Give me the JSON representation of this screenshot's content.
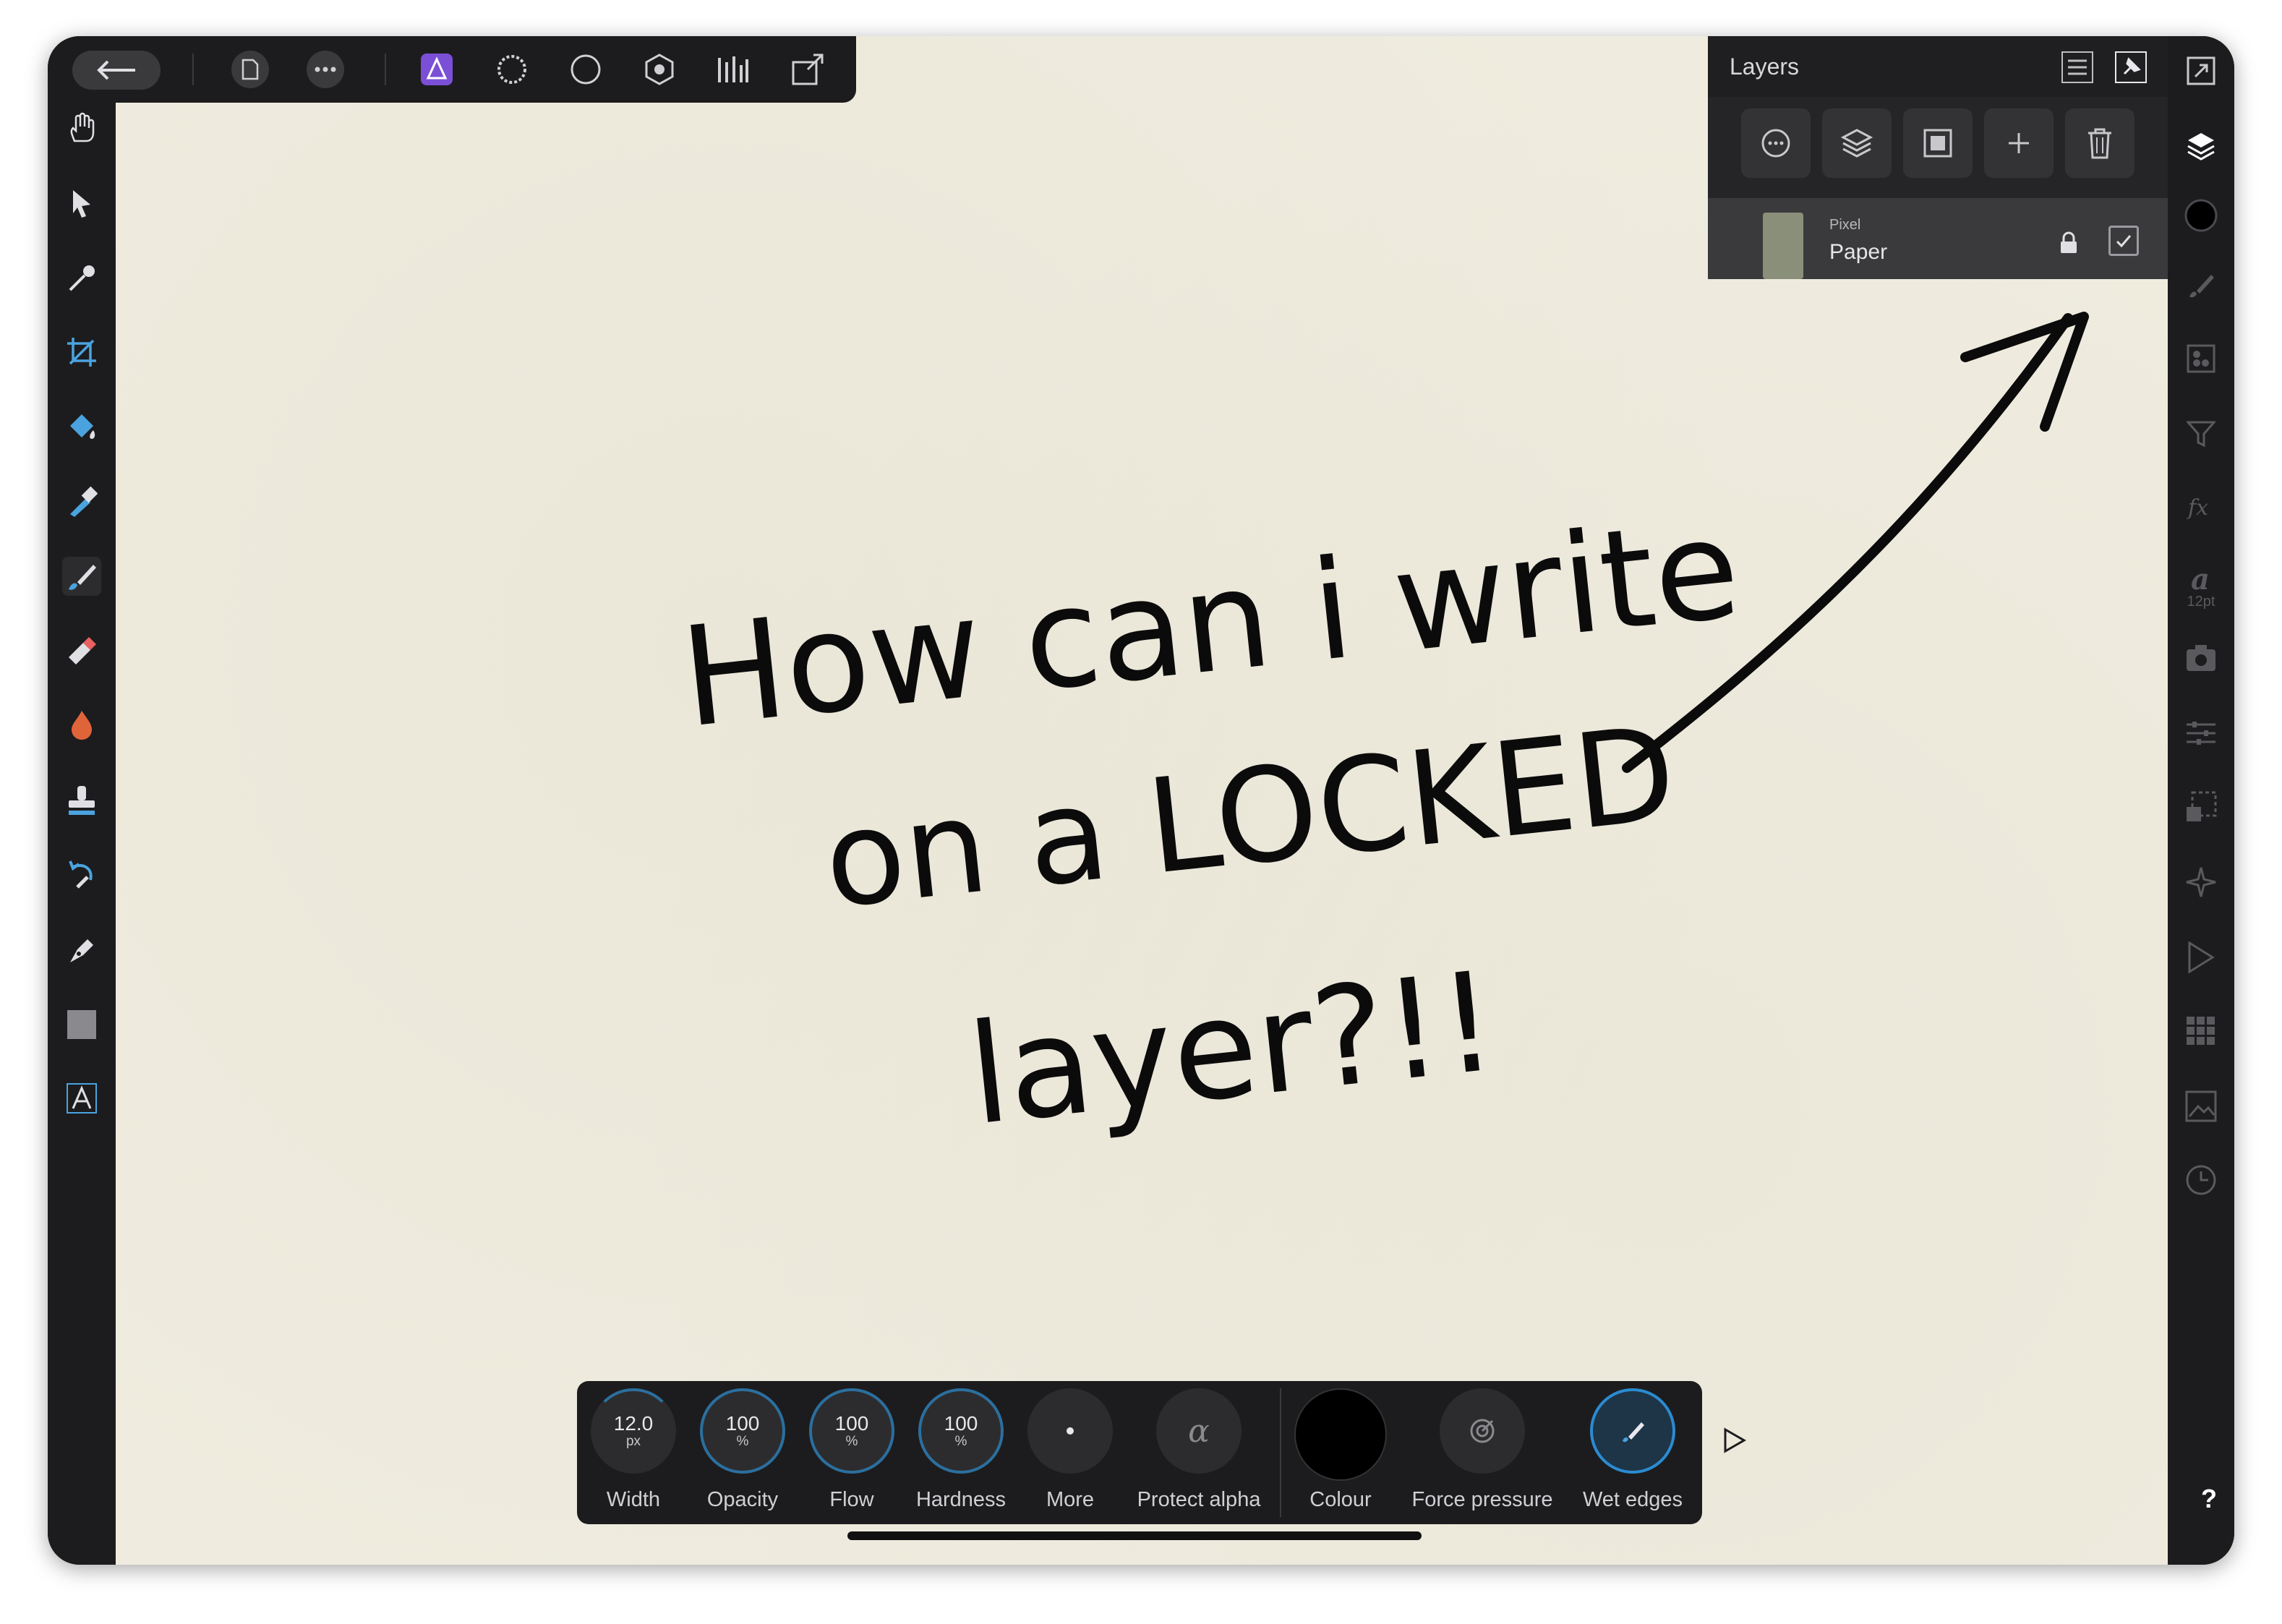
{
  "top_toolbar": {
    "icons": [
      "back-arrow-icon",
      "document-icon",
      "more-icon",
      "photo-persona-icon",
      "liquify-persona-icon",
      "develop-persona-icon",
      "tone-mapping-persona-icon",
      "levels-icon",
      "export-persona-icon"
    ]
  },
  "left_tools": [
    "hand-tool-icon",
    "move-tool-icon",
    "eyedropper-tool-icon",
    "crop-tool-icon",
    "flood-fill-tool-icon",
    "selection-brush-tool-icon",
    "paint-brush-tool-icon",
    "erase-brush-tool-icon",
    "burn-brush-tool-icon",
    "clone-stamp-tool-icon",
    "undo-brush-tool-icon",
    "pen-tool-icon",
    "rectangle-tool-icon",
    "text-tool-icon"
  ],
  "layers_panel": {
    "title": "Layers",
    "buttons": [
      "layer-options-icon",
      "layer-stack-icon",
      "mask-icon",
      "add-layer-icon",
      "delete-layer-icon"
    ],
    "layer": {
      "type": "Pixel",
      "name": "Paper",
      "locked": true,
      "visible": true
    }
  },
  "right_studio": {
    "text_size": "12pt",
    "icons": [
      "navigator-icon",
      "layers-icon",
      "colour-icon",
      "brushes-icon",
      "channels-icon",
      "adjustments-icon",
      "fx-icon",
      "text-styles-icon",
      "snapshots-icon",
      "transform-icon",
      "history-icon",
      "macros-icon",
      "stock-icon",
      "swatches-icon",
      "export-icon",
      "navigator-clock-icon",
      "help-icon"
    ]
  },
  "canvas": {
    "handwriting_lines": [
      "How can i write",
      "on a LOCKED",
      "layer?!!"
    ]
  },
  "context_toolbar": {
    "width": {
      "value": "12.0",
      "unit": "px",
      "label": "Width"
    },
    "opacity": {
      "value": "100",
      "unit": "%",
      "label": "Opacity"
    },
    "flow": {
      "value": "100",
      "unit": "%",
      "label": "Flow"
    },
    "hardness": {
      "value": "100",
      "unit": "%",
      "label": "Hardness"
    },
    "more": {
      "label": "More"
    },
    "protect_alpha": {
      "label": "Protect alpha",
      "symbol": "α"
    },
    "colour": {
      "label": "Colour",
      "value": "#000000"
    },
    "force_pressure": {
      "label": "Force pressure"
    },
    "wet_edges": {
      "label": "Wet edges",
      "active": true
    }
  },
  "help": {
    "label": "?"
  },
  "colors": {
    "accent": "#2b6f9e",
    "canvas": "#efecdf",
    "ui": "#1c1c1e",
    "persona": "#7b4fd6"
  }
}
